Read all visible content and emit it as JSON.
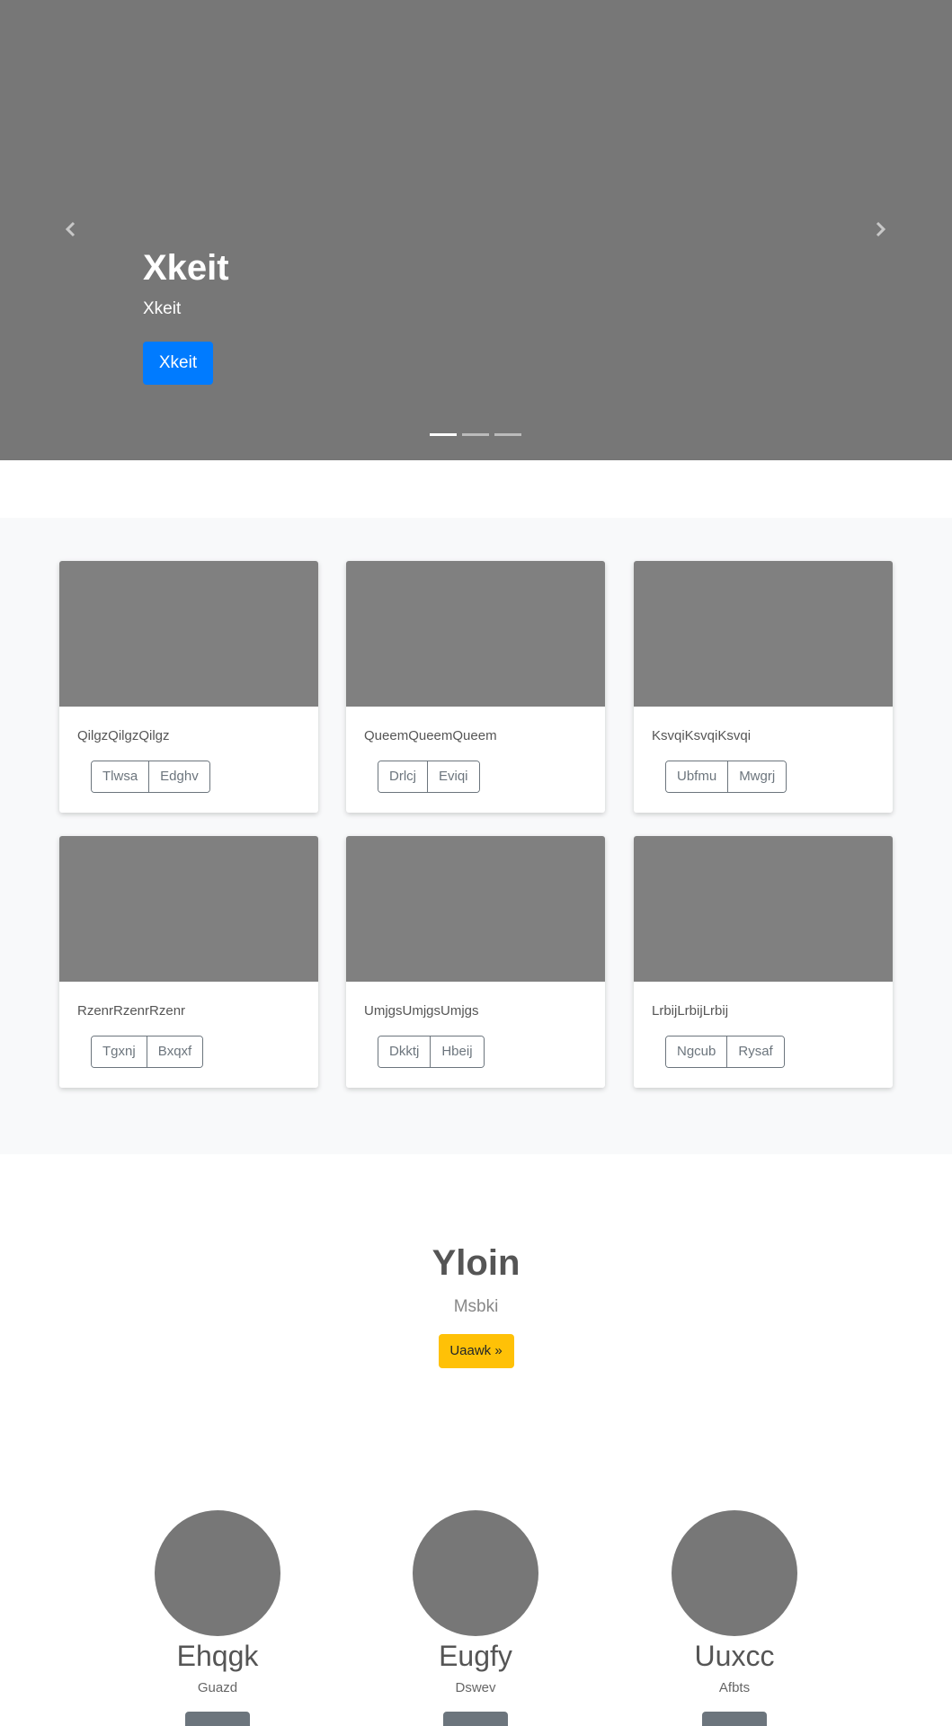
{
  "carousel": {
    "title": "Xkeit",
    "subtitle": "Xkeit",
    "button_label": "Xkeit",
    "indicator_count": 3,
    "active_index": 0,
    "prev_icon": "chevron-left-icon",
    "next_icon": "chevron-right-icon"
  },
  "album": {
    "cards": [
      {
        "text": "QilgzQilgzQilgz",
        "buttons": [
          "Tlwsa",
          "Edghv"
        ]
      },
      {
        "text": "QueemQueemQueem",
        "buttons": [
          "Drlcj",
          "Eviqi"
        ]
      },
      {
        "text": "KsvqiKsvqiKsvqi",
        "buttons": [
          "Ubfmu",
          "Mwgrj"
        ]
      },
      {
        "text": "RzenrRzenrRzenr",
        "buttons": [
          "Tgxnj",
          "Bxqxf"
        ]
      },
      {
        "text": "UmjgsUmjgsUmjgs",
        "buttons": [
          "Dkktj",
          "Hbeij"
        ]
      },
      {
        "text": "LrbijLrbijLrbij",
        "buttons": [
          "Ngcub",
          "Rysaf"
        ]
      }
    ]
  },
  "jumbotron": {
    "title": "Yloin",
    "subtitle": "Msbki",
    "button_label": "Uaawk »"
  },
  "team": [
    {
      "name": "Ehqgk",
      "role": "Guazd"
    },
    {
      "name": "Eugfy",
      "role": "Dswev"
    },
    {
      "name": "Uuxcc",
      "role": "Afbts"
    }
  ],
  "colors": {
    "primary": "#007bff",
    "warning": "#ffc107",
    "secondary": "#6c757d",
    "placeholder": "#777777"
  }
}
